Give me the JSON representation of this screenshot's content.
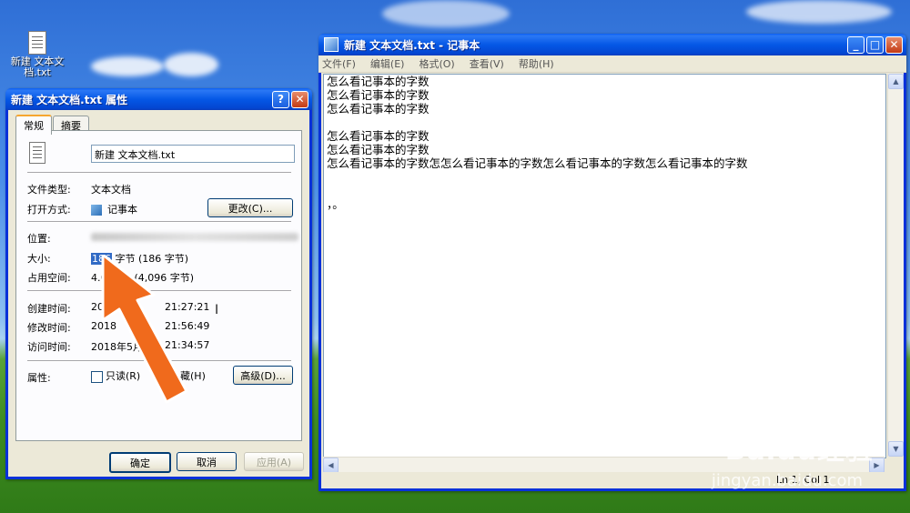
{
  "desktop": {
    "icon_label": "新建 文本文档.txt"
  },
  "properties": {
    "title": "新建 文本文档.txt 属性",
    "tabs": [
      "常规",
      "摘要"
    ],
    "filename": "新建 文本文档.txt",
    "type_label": "文件类型:",
    "type_value": "文本文档",
    "opens_label": "打开方式:",
    "opens_value": "记事本",
    "change_button": "更改(C)...",
    "location_label": "位置:",
    "size_label": "大小:",
    "size_value_highlight": "186",
    "size_value_rest": " 字节 (186 字节)",
    "disk_label": "占用空间:",
    "disk_value_start": "4.0",
    "disk_value_end": "(4,096 字节)",
    "created_label": "创建时间:",
    "created_start": "2018",
    "created_end": "21:27:21",
    "modified_label": "修改时间:",
    "modified_start": "2018",
    "modified_end": "21:56:49",
    "accessed_label": "访问时间:",
    "accessed_value": "2018年5月31",
    "accessed_end": "21:34:57",
    "attr_label": "属性:",
    "readonly_label": "只读(R)",
    "hidden_label": "藏(H)",
    "advanced_button": "高级(D)...",
    "ok_button": "确定",
    "cancel_button": "取消",
    "apply_button": "应用(A)"
  },
  "notepad": {
    "title": "新建 文本文档.txt - 记事本",
    "menu": [
      "文件(F)",
      "编辑(E)",
      "格式(O)",
      "查看(V)",
      "帮助(H)"
    ],
    "lines": [
      "怎么看记事本的字数",
      "怎么看记事本的字数",
      "怎么看记事本的字数",
      "",
      "怎么看记事本的字数",
      "怎么看记事本的字数",
      "怎么看记事本的字数怎怎么看记事本的字数怎么看记事本的字数怎么看记事本的字数",
      "",
      "",
      "，。"
    ],
    "status": "Ln 1, Col 1"
  },
  "watermark": {
    "brand": "Baidu经验",
    "url": "jingyan.baidu.com"
  },
  "colors": {
    "titlebar": "#0558e6",
    "arrow": "#f06a1c",
    "selection": "#316ac5"
  }
}
